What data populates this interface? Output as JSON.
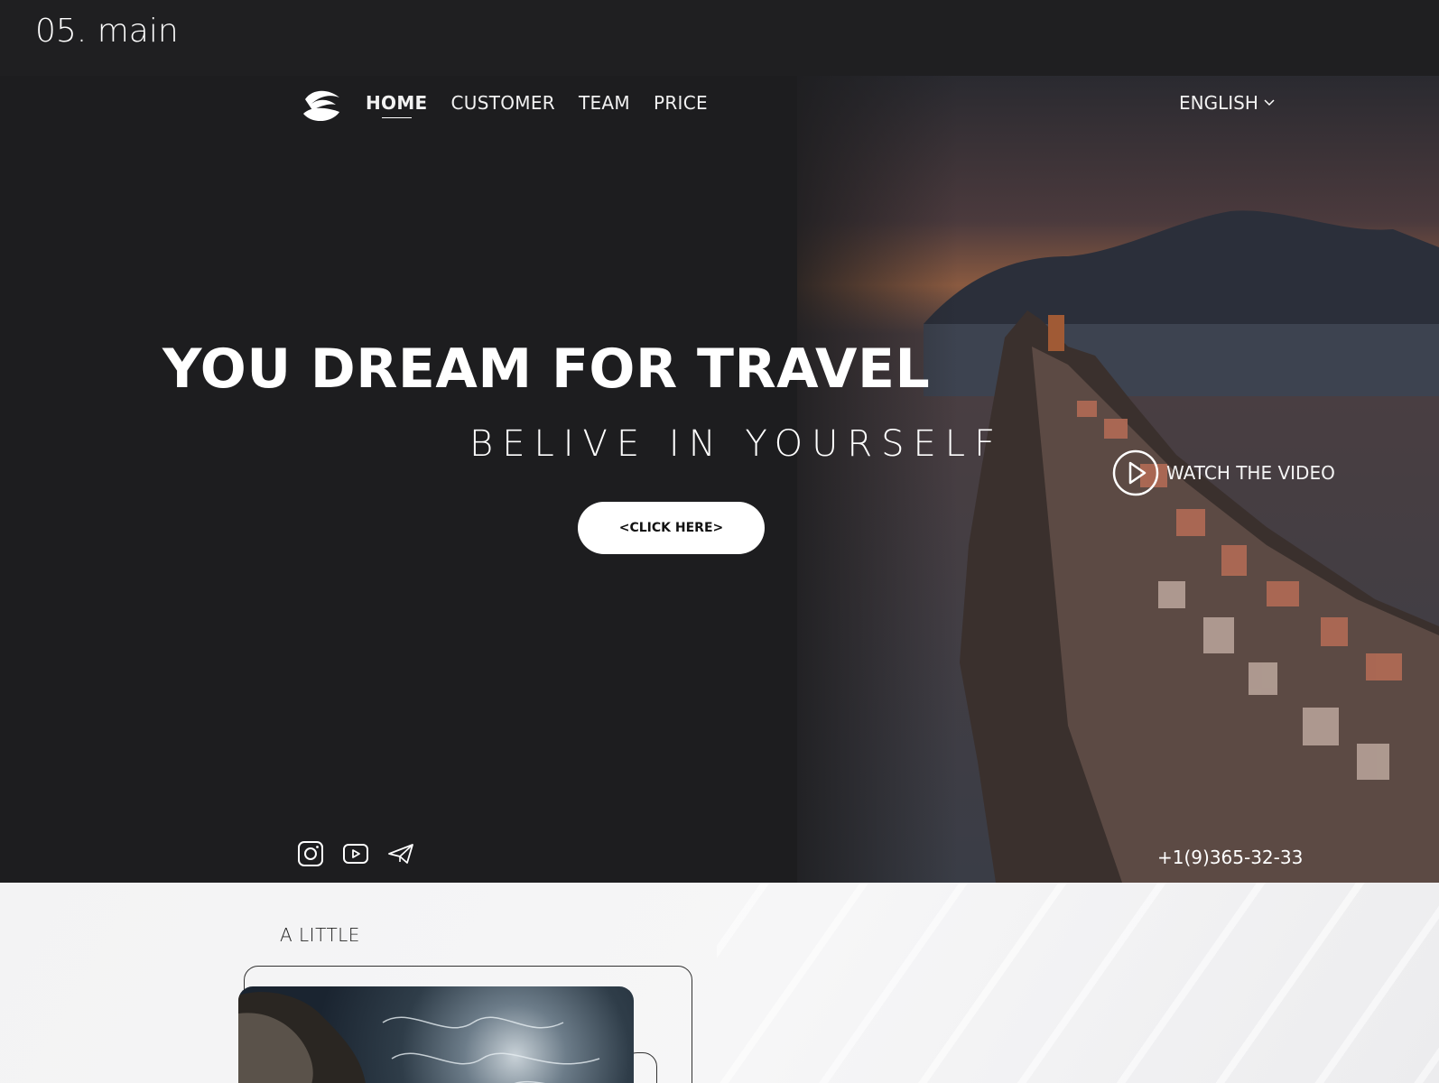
{
  "frame_label": "05. main",
  "nav": {
    "items": [
      {
        "label": "HOME",
        "active": true
      },
      {
        "label": "CUSTOMER",
        "active": false
      },
      {
        "label": "TEAM",
        "active": false
      },
      {
        "label": "PRICE",
        "active": false
      }
    ],
    "language": "ENGLISH"
  },
  "hero": {
    "headline": "YOU DREAM FOR TRAVEL",
    "subline": "BELIVE IN YOURSELF",
    "cta_label": "<CLICK HERE>",
    "watch_label": "WATCH THE VIDEO",
    "phone": "+1(9)365-32-33"
  },
  "socials": [
    "instagram-icon",
    "youtube-icon",
    "telegram-icon"
  ],
  "about": {
    "title": "A LITTLE"
  },
  "colors": {
    "background": "#1f1f21",
    "accent": "#ffffff",
    "light_section": "#f3f3f4"
  }
}
